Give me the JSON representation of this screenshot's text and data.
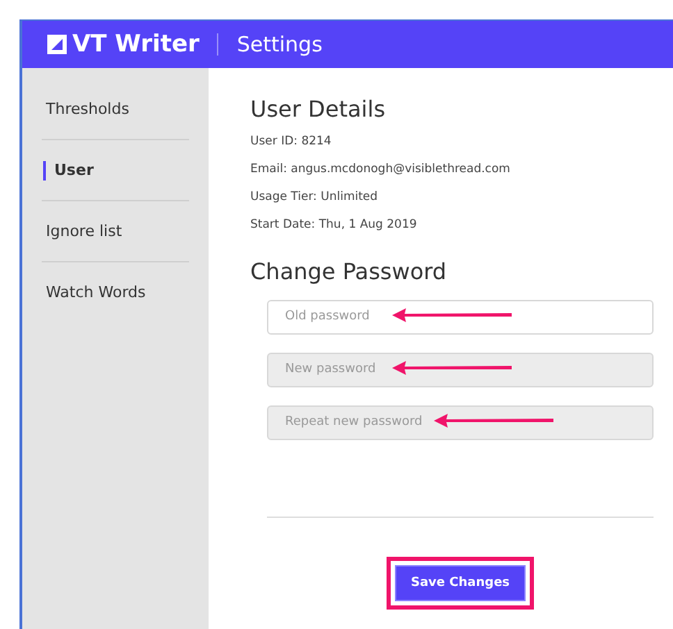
{
  "header": {
    "app_name": "VT Writer",
    "section": "Settings"
  },
  "sidebar": {
    "items": [
      {
        "label": "Thresholds",
        "selected": false
      },
      {
        "label": "User",
        "selected": true
      },
      {
        "label": "Ignore list",
        "selected": false
      },
      {
        "label": "Watch Words",
        "selected": false
      }
    ]
  },
  "user_details": {
    "title": "User Details",
    "lines": [
      "User ID: 8214",
      "Email: angus.mcdonogh@visiblethread.com",
      "Usage Tier: Unlimited",
      "Start Date: Thu, 1 Aug 2019"
    ]
  },
  "change_password": {
    "title": "Change Password",
    "fields": [
      {
        "placeholder": "Old password",
        "disabled": false,
        "annotated": true
      },
      {
        "placeholder": "New password",
        "disabled": true,
        "annotated": true
      },
      {
        "placeholder": "Repeat new password",
        "disabled": true,
        "annotated": true
      }
    ]
  },
  "save_button": {
    "label": "Save Changes",
    "highlighted": true
  }
}
